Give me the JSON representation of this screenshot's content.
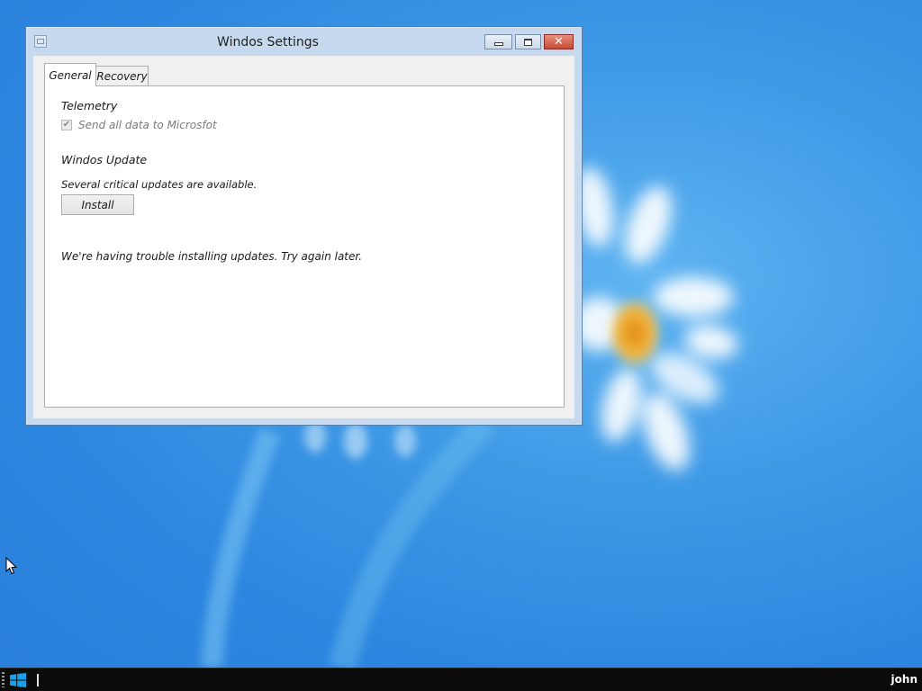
{
  "window": {
    "title": "Windos Settings",
    "close_glyph": "✕"
  },
  "tabs": [
    {
      "label": "General",
      "active": true
    },
    {
      "label": "Recovery",
      "active": false
    }
  ],
  "general": {
    "telemetry_heading": "Telemetry",
    "telemetry_checkbox_label": "Send all data to Microsfot",
    "telemetry_checked": true,
    "telemetry_enabled": false,
    "checkbox_mark": "✔",
    "update_heading": "Windos Update",
    "update_status": "Several critical updates are available.",
    "install_label": "Install",
    "error_message": "We're having trouble installing updates. Try again later."
  },
  "taskbar": {
    "user": "john",
    "start_icon": "windows-logo-icon"
  },
  "colors": {
    "desktop_blue": "#2d86df",
    "window_frame": "#c6d9ee",
    "close_red": "#c64a34",
    "taskbar": "#0b0b0b"
  }
}
